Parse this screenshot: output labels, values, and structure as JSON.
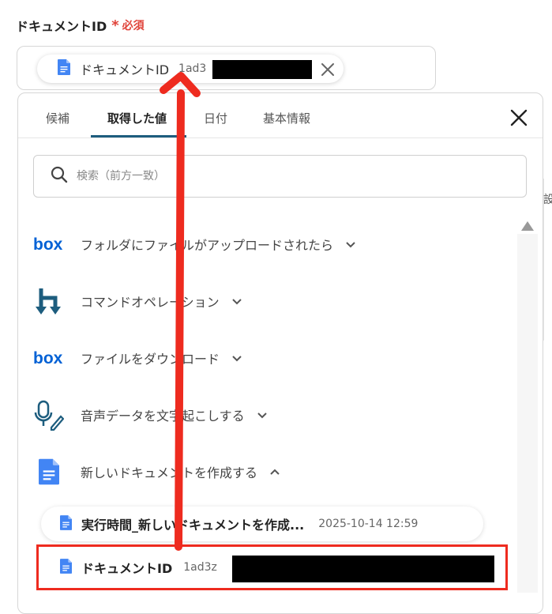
{
  "field": {
    "label": "ドキュメントID",
    "required_mark": "*",
    "required_text": "必須"
  },
  "selected_chip": {
    "label": "ドキュメントID",
    "value": "1ad3",
    "icon": "google-docs-icon",
    "close_icon": "close-icon"
  },
  "panel": {
    "tabs": [
      {
        "label": "候補",
        "active": false
      },
      {
        "label": "取得した値",
        "active": true
      },
      {
        "label": "日付",
        "active": false
      },
      {
        "label": "基本情報",
        "active": false
      }
    ],
    "close_icon": "close-icon"
  },
  "search": {
    "placeholder": "検索（前方一致）",
    "value": "",
    "icon": "search-icon"
  },
  "list": {
    "items": [
      {
        "icon": "box-logo-icon",
        "label": "フォルダにファイルがアップロードされたら",
        "expanded": false
      },
      {
        "icon": "command-operation-icon",
        "label": "コマンドオペレーション",
        "expanded": false
      },
      {
        "icon": "box-logo-icon",
        "label": "ファイルをダウンロード",
        "expanded": false
      },
      {
        "icon": "voice-to-text-icon",
        "label": "音声データを文字起こしする",
        "expanded": false
      },
      {
        "icon": "google-docs-icon",
        "label": "新しいドキュメントを作成する",
        "expanded": true
      }
    ],
    "sub_items": [
      {
        "icon": "google-docs-icon",
        "label": "実行時間_新しいドキュメントを作成...",
        "value": "2025-10-14 12:59"
      },
      {
        "icon": "google-docs-icon",
        "label": "ドキュメントID",
        "value": "1ad3z"
      }
    ]
  },
  "background": {
    "edge_text": "設"
  },
  "colors": {
    "accent_tab": "#1d5d7e",
    "required": "#e0433a",
    "highlight": "#ee2b1f",
    "box_blue": "#0061d5",
    "docs_blue": "#4285f4",
    "command_teal": "#1d5d7e"
  }
}
